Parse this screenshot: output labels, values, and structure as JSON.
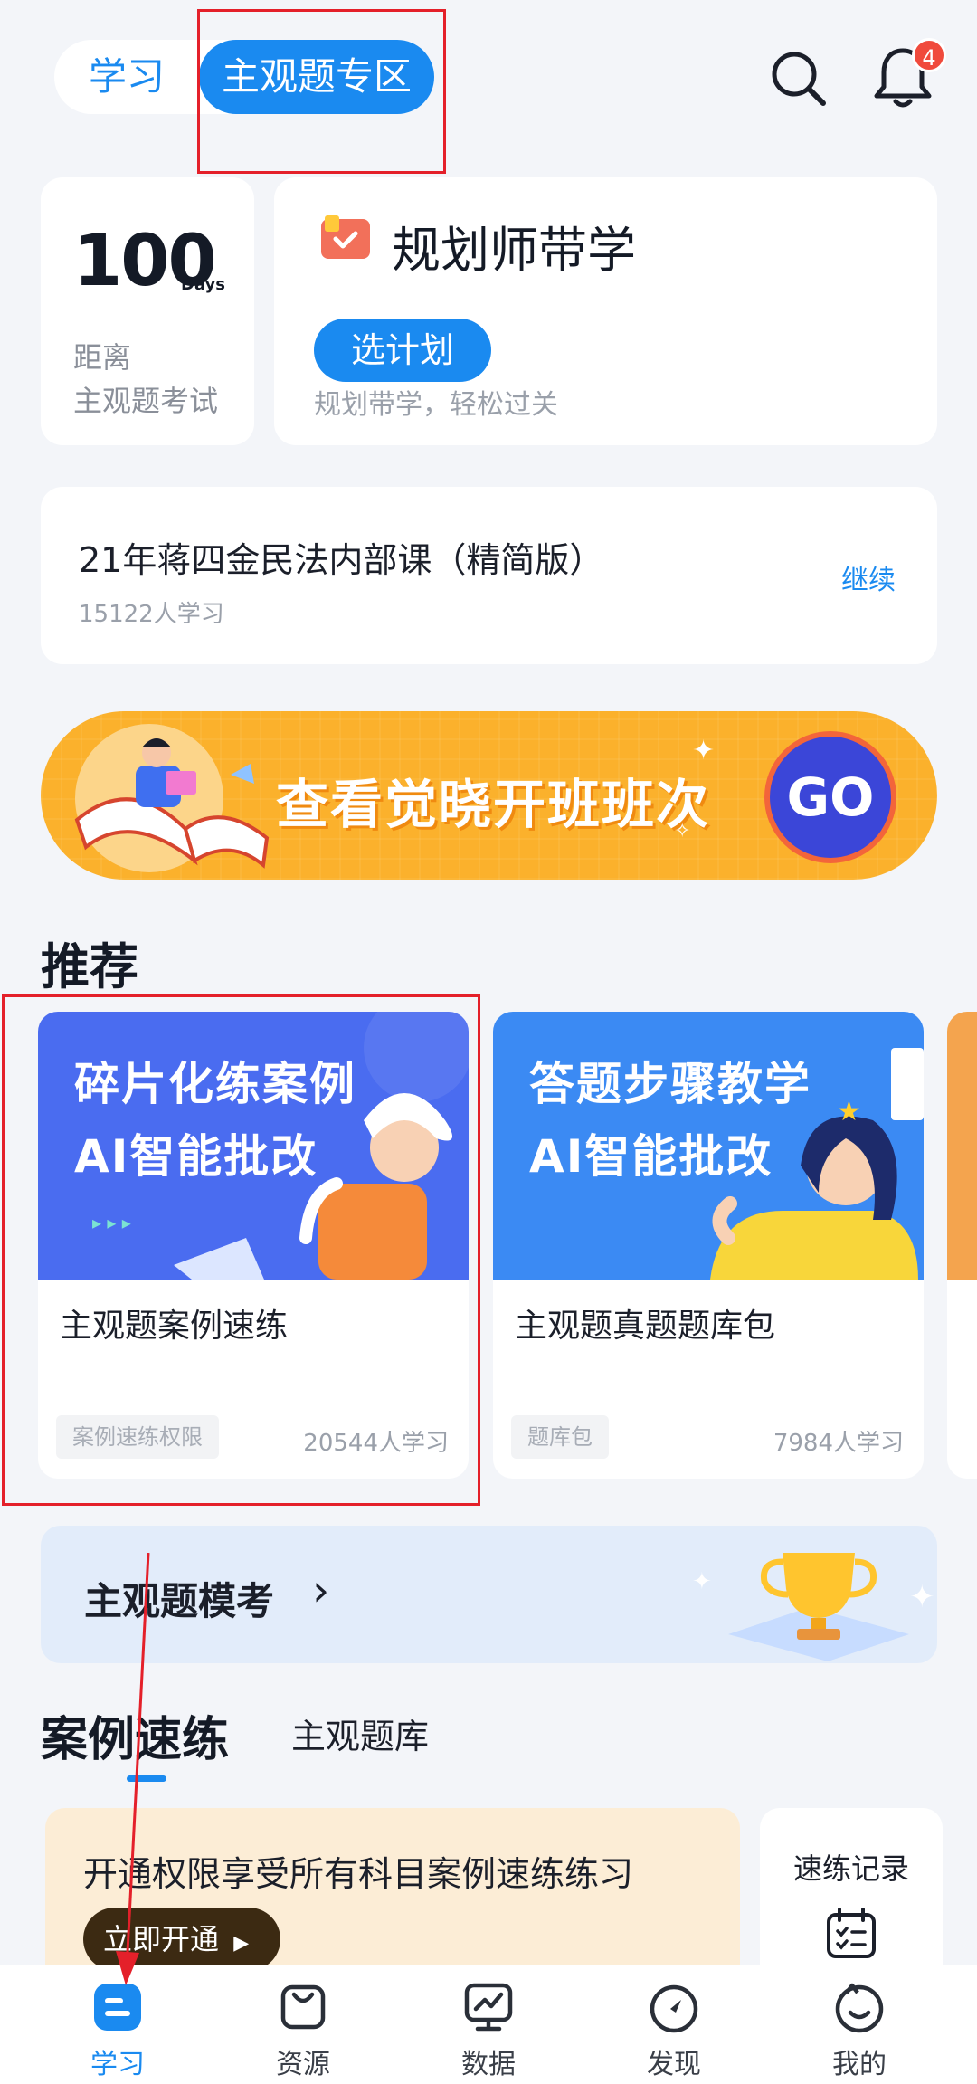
{
  "header": {
    "tab_learn": "学习",
    "tab_subjective": "主观题专区",
    "notification_badge": "4"
  },
  "countdown": {
    "number": "100",
    "unit": "Days",
    "label_line1": "距离",
    "label_line2": "主观题考试"
  },
  "planner": {
    "title": "规划师带学",
    "button": "选计划",
    "subtitle": "规划带学，轻松过关"
  },
  "course": {
    "title": "21年蒋四金民法内部课（精简版）",
    "learners": "15122人学习",
    "continue": "继续"
  },
  "banner": {
    "text": "查看觉晓开班班次",
    "go": "GO"
  },
  "recommend": {
    "title": "推荐",
    "cards": [
      {
        "image_line1": "碎片化练案例",
        "image_line2": "AI智能批改",
        "name": "主观题案例速练",
        "tag": "案例速练权限",
        "learners": "20544人学习",
        "image_color": "#4a6cf0"
      },
      {
        "image_line1": "答题步骤教学",
        "image_line2": "AI智能批改",
        "name": "主观题真题题库包",
        "tag": "题库包",
        "learners": "7984人学习",
        "image_color": "#3b8af3"
      }
    ]
  },
  "mock": {
    "title": "主观题模考",
    "arrow": "›"
  },
  "tabs": {
    "active": "案例速练",
    "other": "主观题库"
  },
  "promo": {
    "text": "开通权限享受所有科目案例速练练习",
    "button": "立即开通"
  },
  "practice_log": {
    "label": "速练记录",
    "icon": "calendar-check-icon"
  },
  "bottom_nav": [
    {
      "label": "学习",
      "icon": "study-icon",
      "active": true
    },
    {
      "label": "资源",
      "icon": "bag-icon",
      "active": false
    },
    {
      "label": "数据",
      "icon": "chart-monitor-icon",
      "active": false
    },
    {
      "label": "发现",
      "icon": "compass-icon",
      "active": false
    },
    {
      "label": "我的",
      "icon": "face-icon",
      "active": false
    }
  ],
  "colors": {
    "accent": "#1a8af0",
    "banner": "#fbb12c",
    "highlight": "#e4202a"
  }
}
